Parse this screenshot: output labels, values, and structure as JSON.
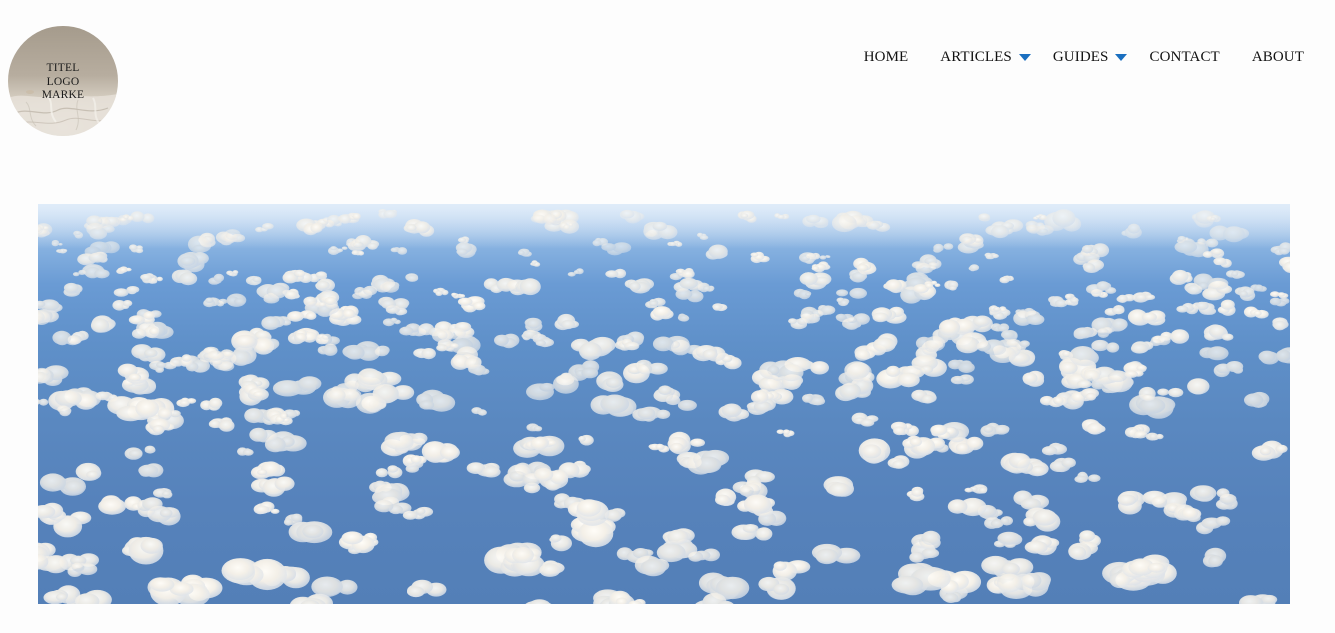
{
  "logo": {
    "lines": [
      "TITEL",
      "LOGO",
      "MARKE"
    ]
  },
  "nav": {
    "items": [
      {
        "label": "HOME",
        "dropdown": false
      },
      {
        "label": "ARTICLES",
        "dropdown": true
      },
      {
        "label": "GUIDES",
        "dropdown": true
      },
      {
        "label": "CONTACT",
        "dropdown": false
      },
      {
        "label": "ABOUT",
        "dropdown": false
      }
    ]
  },
  "colors": {
    "background": "#fdfdfd",
    "text": "#111111",
    "dropdown_caret": "#1a6fc0",
    "sky": "#5a88c0",
    "cloud": "#f7f4ee"
  },
  "icons": {
    "dropdown": "caret-down-icon"
  },
  "hero": {
    "subject": "aerial-view-clouds"
  }
}
